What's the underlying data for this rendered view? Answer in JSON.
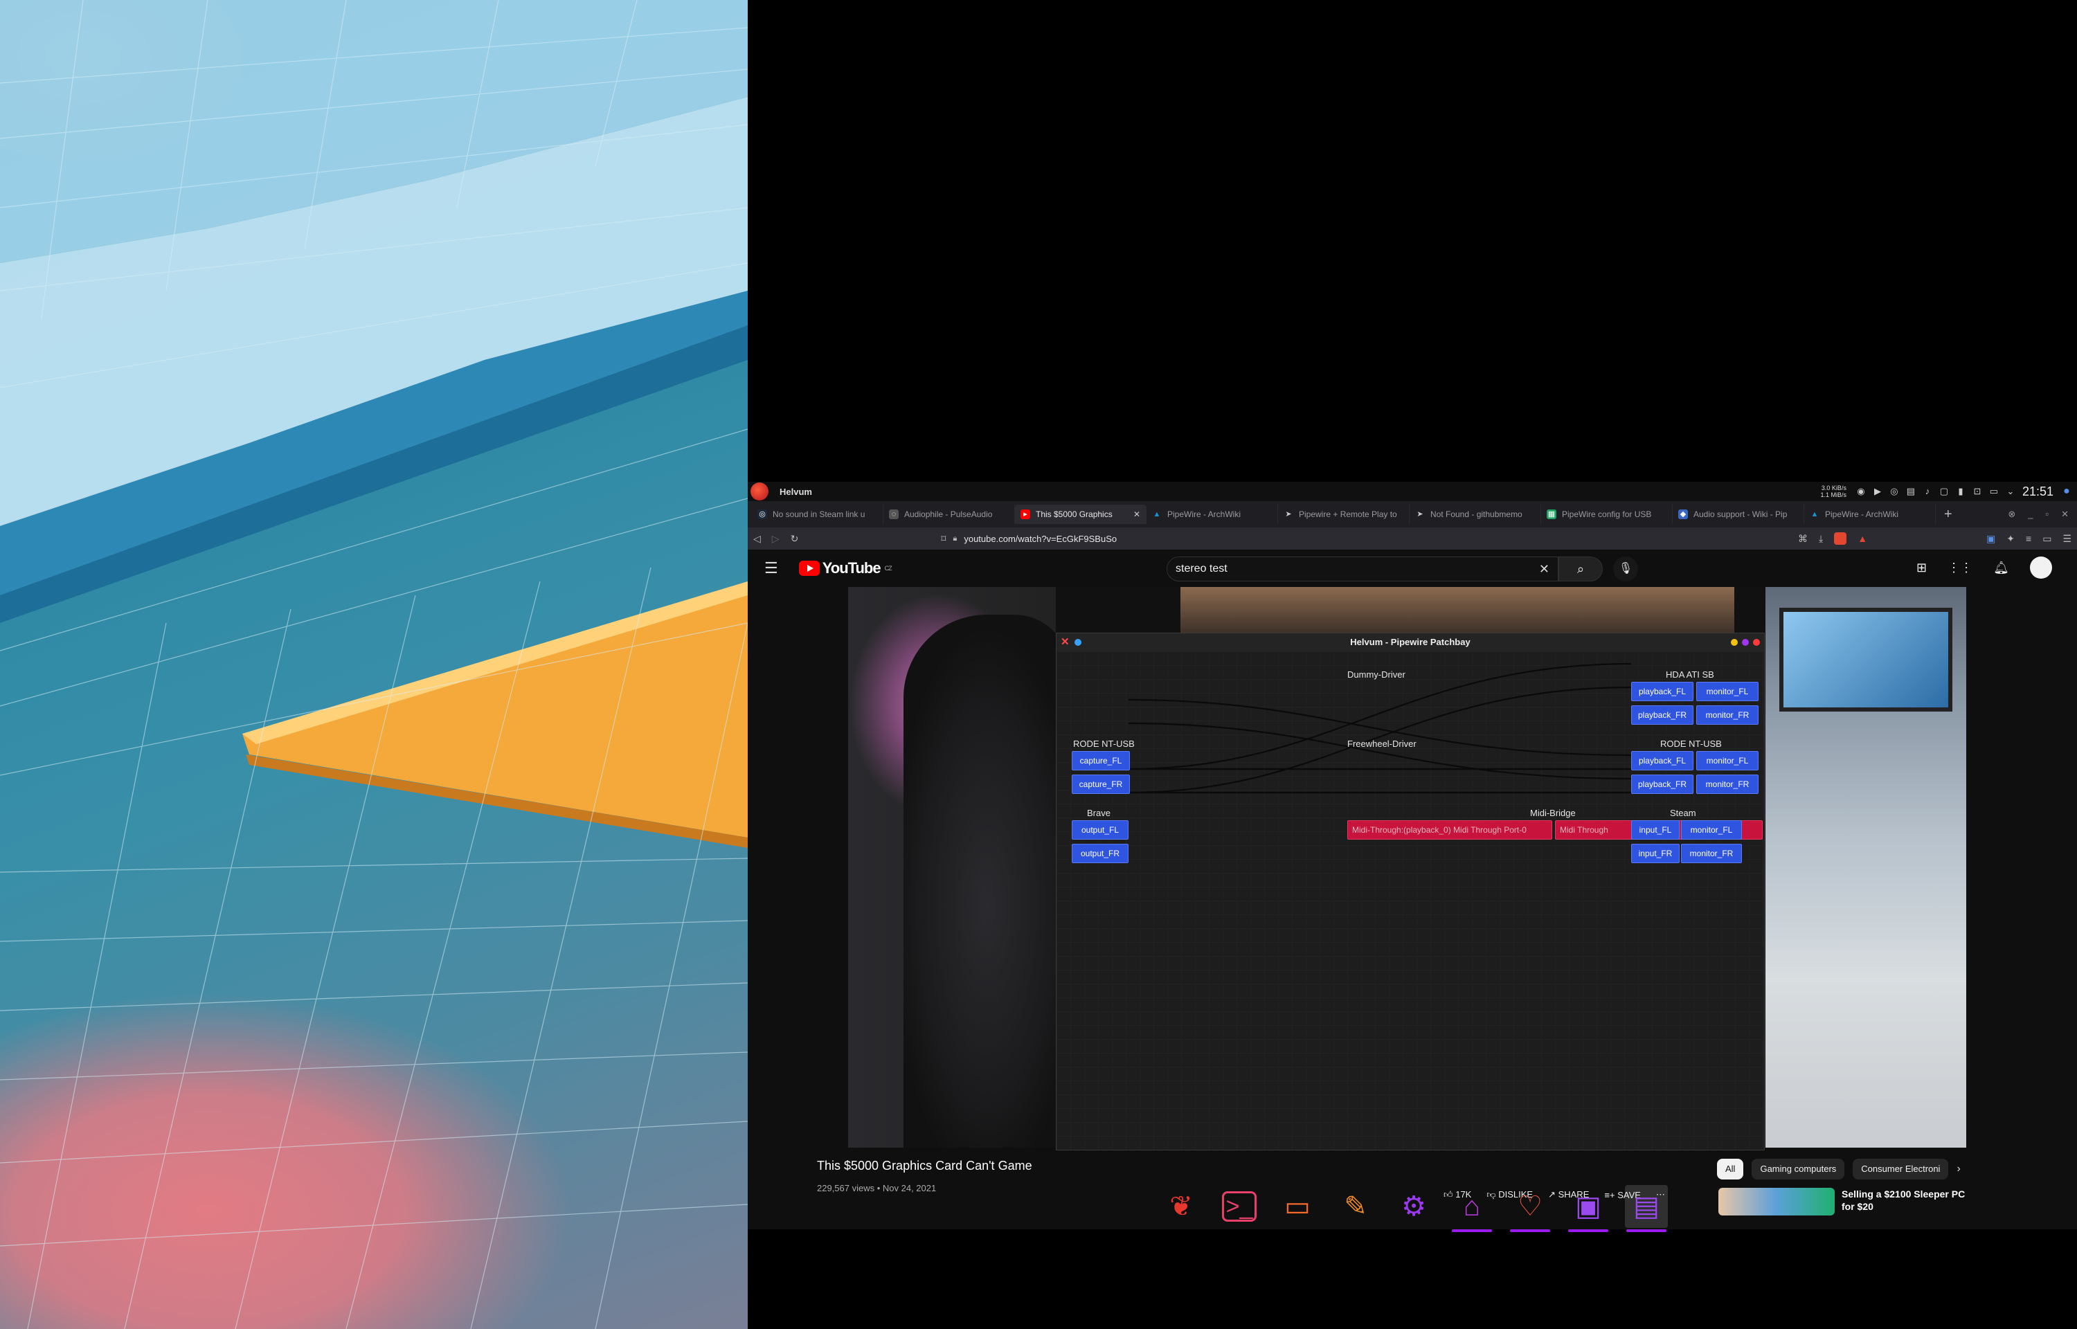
{
  "panel": {
    "app_title": "Helvum",
    "net_up": "3.0 KiB/s",
    "net_down": "1.1 MiB/s",
    "clock": "21:51",
    "tray_icons": [
      "net-arrows-icon",
      "discord-icon",
      "media-play-icon",
      "steam-icon",
      "clipboard-icon",
      "volume-icon",
      "lock-icon",
      "battery-icon",
      "network-icon",
      "display-icon",
      "chevron-down-icon",
      "user-icon"
    ]
  },
  "browser": {
    "tabs": [
      {
        "title": "No sound in Steam link u",
        "favicon": "steam-icon",
        "active": false
      },
      {
        "title": "Audiophile - PulseAudio",
        "favicon": "globe-icon",
        "active": false
      },
      {
        "title": "This $5000 Graphics",
        "favicon": "youtube-icon",
        "active": true
      },
      {
        "title": "PipeWire - ArchWiki",
        "favicon": "archlinux-icon",
        "active": false
      },
      {
        "title": "Pipewire + Remote Play to",
        "favicon": "send-icon",
        "active": false
      },
      {
        "title": "Not Found - githubmemo",
        "favicon": "send-icon",
        "active": false
      },
      {
        "title": "PipeWire config for USB",
        "favicon": "sheet-icon",
        "active": false
      },
      {
        "title": "Audio support - Wiki - Pip",
        "favicon": "wiki-icon",
        "active": false
      },
      {
        "title": "PipeWire - ArchWiki",
        "favicon": "archlinux-icon",
        "active": false
      }
    ],
    "new_tab": "+",
    "url": "youtube.com/watch?v=EcGkF9SBuSo"
  },
  "youtube": {
    "logo_text": "YouTube",
    "region": "CZ",
    "search_value": "stereo test",
    "video_title": "This $5000 Graphics Card Can't Game",
    "video_meta": "229,567 views • Nov 24, 2021",
    "likes": "17K",
    "dislike_label": "DISLIKE",
    "share_label": "SHARE",
    "save_label": "SAVE",
    "chips": [
      "All",
      "Gaming computers",
      "Consumer Electroni"
    ],
    "recommended_title": "Selling a $2100 Sleeper PC for $20"
  },
  "helvum": {
    "title": "Helvum - Pipewire Patchbay",
    "nodes": {
      "hda_ati": {
        "title": "HDA ATI SB",
        "ports": [
          "playback_FL",
          "monitor_FL",
          "playback_FR",
          "monitor_FR"
        ]
      },
      "dummy": {
        "title": "Dummy-Driver"
      },
      "freewheel": {
        "title": "Freewheel-Driver"
      },
      "rode_in": {
        "title": "RODE NT-USB",
        "ports": [
          "capture_FL",
          "capture_FR"
        ]
      },
      "rode_out": {
        "title": "RODE NT-USB",
        "ports": [
          "playback_FL",
          "monitor_FL",
          "playback_FR",
          "monitor_FR"
        ]
      },
      "brave": {
        "title": "Brave",
        "ports": [
          "output_FL",
          "output_FR"
        ]
      },
      "midi": {
        "title": "Midi-Bridge",
        "ports": [
          "Midi-Through:(playback_0) Midi Through Port-0",
          "Midi Through"
        ]
      },
      "steam": {
        "title": "Steam",
        "ports": [
          "input_FL",
          "monitor_FL",
          "input_FR",
          "monitor_FR"
        ]
      }
    }
  },
  "colors": {
    "port_blue": "#2f55e0",
    "port_midi": "#c8143c",
    "yt_red": "#ff0000",
    "dock_indicator": "#9b1cf0"
  },
  "dock": [
    "helvum-icon",
    "terminal-icon",
    "files-icon",
    "text-editor-icon",
    "settings-icon",
    "store-icon",
    "heart-app-icon",
    "image-viewer-icon",
    "virtual-machine-icon"
  ]
}
